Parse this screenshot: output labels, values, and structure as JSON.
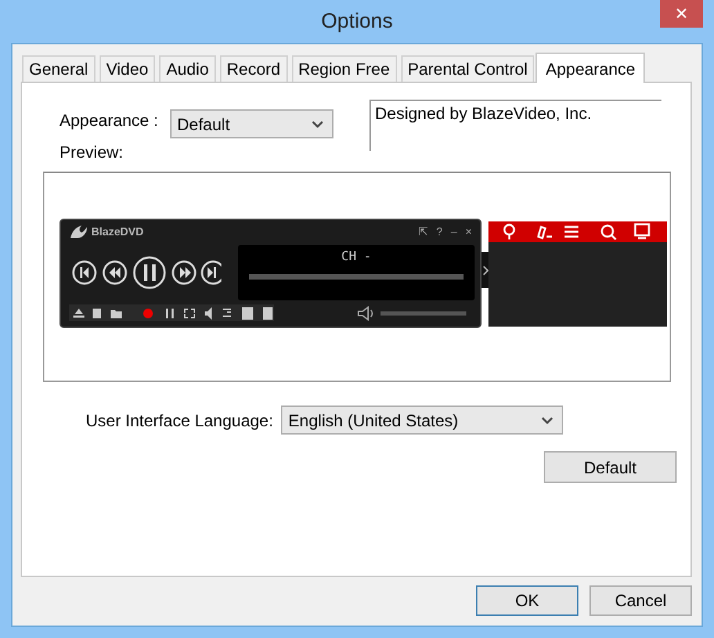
{
  "window": {
    "title": "Options",
    "close": "✕"
  },
  "tabs": [
    {
      "label": "General",
      "selected": false
    },
    {
      "label": "Video",
      "selected": false
    },
    {
      "label": "Audio",
      "selected": false
    },
    {
      "label": "Record",
      "selected": false
    },
    {
      "label": "Region Free",
      "selected": false
    },
    {
      "label": "Parental Control",
      "selected": false
    },
    {
      "label": "Appearance",
      "selected": true
    }
  ],
  "appearance": {
    "label": "Appearance :",
    "value": "Default",
    "preview_label": "Preview:",
    "description": "Designed by BlazeVideo, Inc."
  },
  "player": {
    "logo": "BlazeDVD",
    "display": "CH -",
    "window_buttons": [
      "⇱",
      "?",
      "–",
      "×"
    ]
  },
  "language": {
    "label": "User Interface Language:",
    "value": "English (United States)"
  },
  "default_button": "Default",
  "buttons": [
    {
      "label": "OK",
      "selected": true
    },
    {
      "label": "Cancel",
      "selected": false
    }
  ]
}
